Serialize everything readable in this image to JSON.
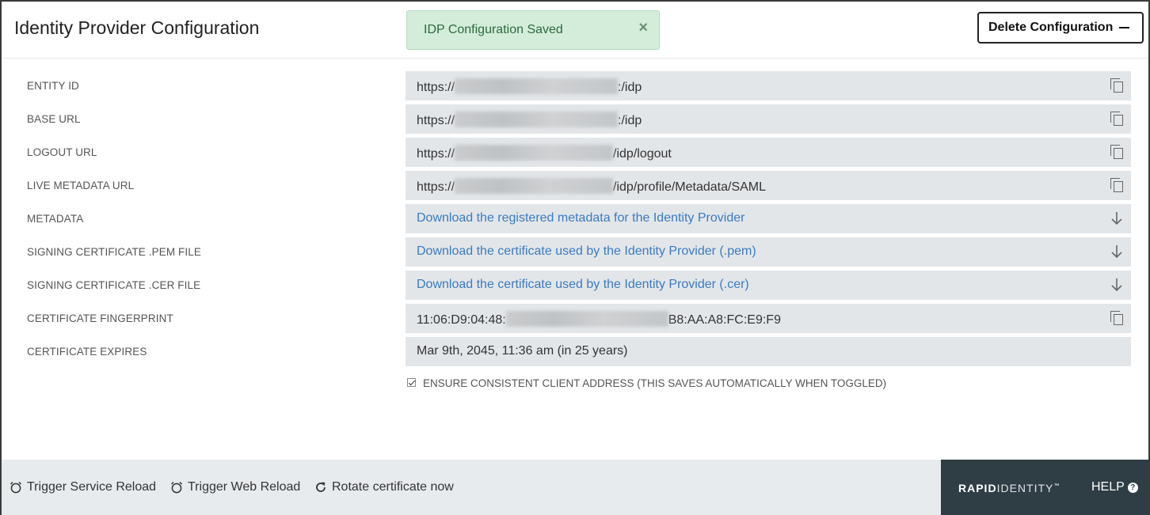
{
  "header": {
    "title": "Identity Provider Configuration",
    "toast_message": "IDP Configuration Saved",
    "toast_close": "×",
    "delete_label": "Delete Configuration"
  },
  "fields": [
    {
      "label": "ENTITY ID",
      "prefix": "https://",
      "suffix": ":/idp",
      "type": "copy"
    },
    {
      "label": "BASE URL",
      "prefix": "https://",
      "suffix": ":/idp",
      "type": "copy"
    },
    {
      "label": "LOGOUT URL",
      "prefix": "https://",
      "suffix": "/idp/logout",
      "type": "copy"
    },
    {
      "label": "LIVE METADATA URL",
      "prefix": "https://",
      "suffix": "/idp/profile/Metadata/SAML",
      "type": "copy"
    },
    {
      "label": "METADATA",
      "link": "Download the registered metadata for the Identity Provider",
      "type": "download"
    },
    {
      "label": "SIGNING CERTIFICATE .PEM FILE",
      "link": "Download the certificate used by the Identity Provider (.pem)",
      "type": "download"
    },
    {
      "label": "SIGNING CERTIFICATE .CER FILE",
      "link": "Download the certificate used by the Identity Provider (.cer)",
      "type": "download"
    },
    {
      "label": "CERTIFICATE FINGERPRINT",
      "prefix": "11:06:D9:04:48:",
      "suffix": "B8:AA:A8:FC:E9:F9",
      "type": "copy"
    },
    {
      "label": "CERTIFICATE EXPIRES",
      "value": "Mar 9th, 2045, 11:36 am (in 25 years)",
      "type": "text"
    }
  ],
  "checkbox": {
    "label": "ENSURE CONSISTENT CLIENT ADDRESS (THIS SAVES AUTOMATICALLY WHEN TOGGLED)",
    "checked": true
  },
  "footer": {
    "actions": [
      {
        "label": "Trigger Service Reload",
        "icon": "alarm-clock-icon"
      },
      {
        "label": "Trigger Web Reload",
        "icon": "alarm-clock-icon"
      },
      {
        "label": "Rotate certificate now",
        "icon": "refresh-icon"
      }
    ],
    "brand_bold": "RAPID",
    "brand_light": "IDENTITY",
    "brand_tm": "™",
    "help_label": "HELP",
    "help_icon": "?"
  },
  "colors": {
    "toast_bg": "#d4edda",
    "link": "#3a7bc0",
    "field_bg": "#e3e6e9",
    "brand_panel": "#2f3d45"
  }
}
